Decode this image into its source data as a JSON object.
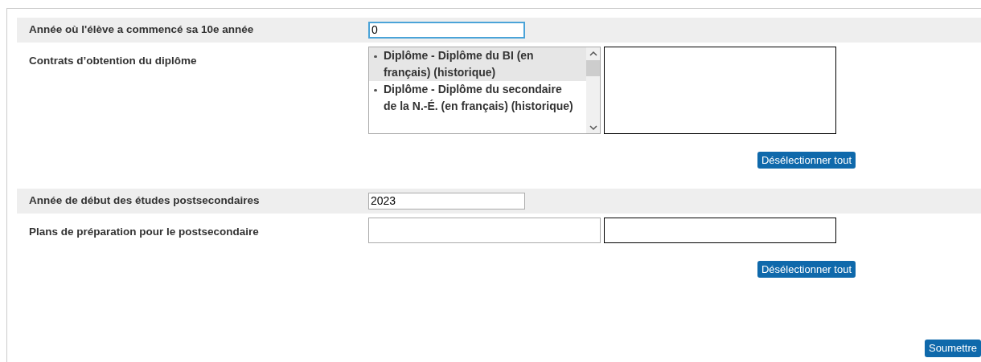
{
  "fields": [
    {
      "kind": "text",
      "label": "Année où l'élève a commencé sa 10e année",
      "value": "0",
      "focused": true
    },
    {
      "kind": "multiselect",
      "label": "Contrats d’obtention du diplôme",
      "options": [
        {
          "text": "Diplôme - Diplôme du BI (en français) (historique)",
          "selected": true
        },
        {
          "text": "Diplôme - Diplôme du secondaire de la N.-É. (en français) (historique)",
          "selected": false
        }
      ],
      "button": "Désélectionner tout"
    },
    {
      "kind": "text",
      "label": "Année de début des études postsecondaires",
      "value": "2023",
      "focused": false
    },
    {
      "kind": "multiselect",
      "label": "Plans de préparation pour le postsecondaire",
      "button": "Désélectionner tout"
    }
  ],
  "submit": "Soumettre"
}
